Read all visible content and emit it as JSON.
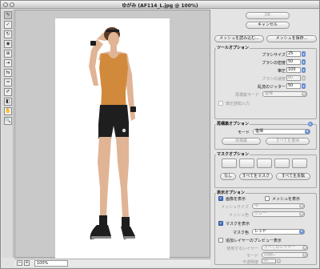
{
  "window": {
    "title": "ゆがみ (AF114_L.jpg @ 100%)"
  },
  "statusbar": {
    "zoom": "100%"
  },
  "buttons": {
    "ok": "OK",
    "cancel": "キャンセル",
    "load_mesh": "メッシュを読み込む...",
    "save_mesh": "メッシュを保存..."
  },
  "tool_options": {
    "title": "ツールオプション",
    "brush_size": {
      "label": "ブラシサイズ",
      "value": "25"
    },
    "brush_density": {
      "label": "ブラシの密度",
      "value": "50"
    },
    "brush_pressure": {
      "label": "筆圧",
      "value": "100"
    },
    "brush_rate": {
      "label": "ブラシの速度",
      "value": "80"
    },
    "turbulent_jitter": {
      "label": "乱流のジッター",
      "value": "50"
    },
    "reconstruct_mode": {
      "label": "再構築モード",
      "value": "復帰"
    },
    "stylus_pressure": "筆圧感知入力"
  },
  "reconstruct_options": {
    "title": "再構築オプション",
    "mode_label": "モード",
    "mode_value": "復帰",
    "reconstruct_btn": "再構築",
    "restore_all_btn": "すべてを復帰"
  },
  "mask_options": {
    "title": "マスクオプション",
    "none_btn": "なし",
    "mask_all_btn": "すべてをマスク",
    "invert_all_btn": "すべてを反転"
  },
  "view_options": {
    "title": "表示オプション",
    "show_image": "画像を表示",
    "show_mesh": "メッシュを表示",
    "mesh_size": {
      "label": "メッシュサイズ",
      "value": "中"
    },
    "mesh_color": {
      "label": "メッシュ色",
      "value": "グレー"
    },
    "show_mask": "マスクを表示",
    "mask_color": {
      "label": "マスク色",
      "value": "レッド"
    },
    "show_backdrop": "追加レイヤーのプレビュー表示",
    "use_layer": {
      "label": "使用するレイヤー",
      "value": "すべてのレイヤー"
    },
    "backdrop_mode": {
      "label": "モード",
      "value": "前面に"
    },
    "opacity": {
      "label": "不透明度",
      "value": "50"
    }
  },
  "photo_colors": {
    "tank_top": "#d18a3c",
    "shorts": "#1e1e1e",
    "skin": "#e0b494",
    "hair": "#5a3a26",
    "background": "#ffffff"
  }
}
